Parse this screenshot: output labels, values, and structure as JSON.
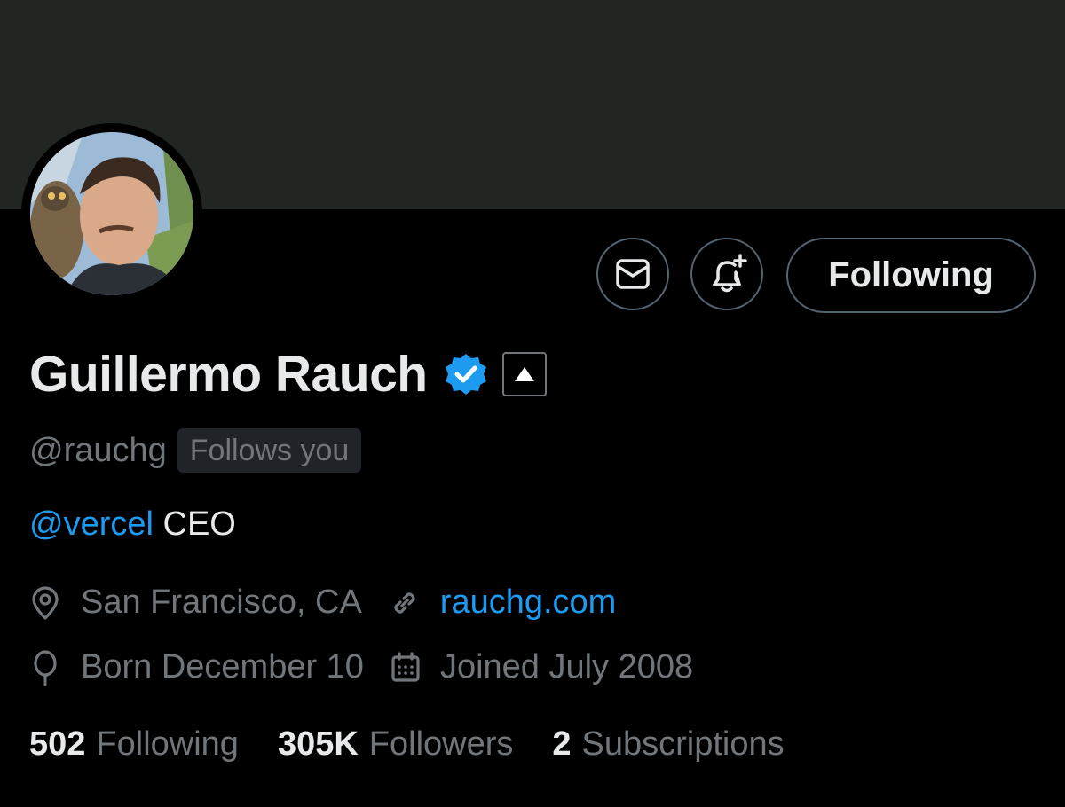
{
  "profile": {
    "display_name": "Guillermo Rauch",
    "handle": "@rauchg",
    "follows_you_badge": "Follows you",
    "bio_mention": "@vercel",
    "bio_text": " CEO",
    "location": "San Francisco, CA",
    "website": "rauchg.com",
    "birthday": "Born December 10",
    "joined": "Joined July 2008"
  },
  "actions": {
    "following_label": "Following"
  },
  "stats": {
    "following_count": "502",
    "following_label": "Following",
    "followers_count": "305K",
    "followers_label": "Followers",
    "subscriptions_count": "2",
    "subscriptions_label": "Subscriptions"
  },
  "icons": {
    "message": "mail-icon",
    "notify": "bell-plus-icon",
    "verified": "verified-badge-icon",
    "location": "location-pin-icon",
    "website": "link-icon",
    "birthday": "balloon-icon",
    "joined": "calendar-icon"
  },
  "colors": {
    "background": "#000000",
    "banner": "#222622",
    "accent": "#1d9bf0",
    "secondary_text": "#71767b",
    "primary_text": "#e7e9ea",
    "border": "#536471"
  }
}
